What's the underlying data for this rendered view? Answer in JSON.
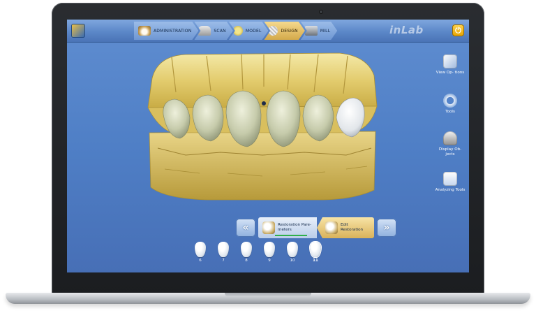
{
  "workflow": {
    "steps": [
      {
        "label": "ADMINISTRATION",
        "icon": "patient-admin-icon",
        "active": false
      },
      {
        "label": "SCAN",
        "icon": "scanner-icon",
        "active": false
      },
      {
        "label": "MODEL",
        "icon": "model-icon",
        "active": false
      },
      {
        "label": "DESIGN",
        "icon": "design-icon",
        "active": true
      },
      {
        "label": "MILL",
        "icon": "milling-machine-icon",
        "active": false
      }
    ]
  },
  "app": {
    "logo_text": "inLab",
    "power_icon": "power-icon"
  },
  "side_tools": [
    {
      "label": "View Op- tions",
      "icon": "view-options-icon"
    },
    {
      "label": "Tools",
      "icon": "tools-ring-icon"
    },
    {
      "label": "Display Ob- jects",
      "icon": "display-objects-icon"
    },
    {
      "label": "Analyzing Tools",
      "icon": "analyzing-tools-icon"
    }
  ],
  "phase_bar": {
    "prev_icon": "double-chevron-left-icon",
    "next_icon": "double-chevron-right-icon",
    "phases": [
      {
        "label": "Restoration Pare- meters",
        "active": false
      },
      {
        "label": "Edit Restoration",
        "active": true
      }
    ]
  },
  "teeth": [
    {
      "number": "6",
      "selected": false
    },
    {
      "number": "7",
      "selected": false
    },
    {
      "number": "8",
      "selected": false
    },
    {
      "number": "9",
      "selected": false
    },
    {
      "number": "10",
      "selected": false
    },
    {
      "number": "11",
      "selected": true
    }
  ],
  "colors": {
    "screen_background": "#4f7fc6",
    "model_gold": "#e8d27a",
    "restoration_gray": "#c9cdb0",
    "active_step": "#e8c46c",
    "progress_green": "#2fb04a"
  }
}
